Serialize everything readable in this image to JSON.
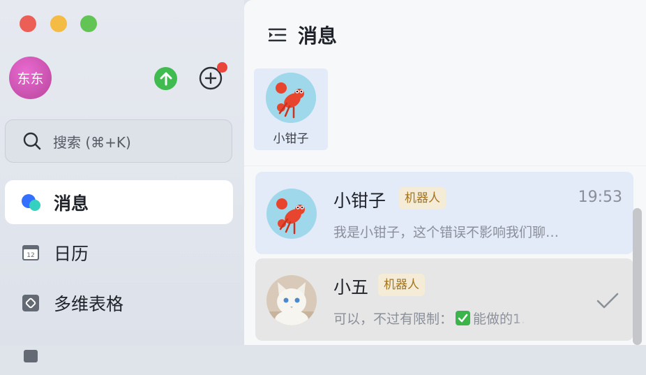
{
  "window": {
    "controls": [
      "close",
      "minimize",
      "zoom"
    ]
  },
  "sidebar": {
    "avatar_text": "东东",
    "search_label": "搜索 (⌘+K)",
    "nav": [
      {
        "label": "消息",
        "icon": "chat-bubbles-icon",
        "active": true
      },
      {
        "label": "日历",
        "icon": "calendar-icon",
        "calendar_day": "12"
      },
      {
        "label": "多维表格",
        "icon": "base-table-icon"
      }
    ]
  },
  "main": {
    "title": "消息",
    "pinned": [
      {
        "name": "小钳子",
        "avatar": "lobster-avatar"
      }
    ],
    "chats": [
      {
        "name": "小钳子",
        "tag": "机器人",
        "time": "19:53",
        "message": "我是小钳子，这个错误不影响我们聊…",
        "avatar": "lobster-avatar",
        "selected": true
      },
      {
        "name": "小五",
        "tag": "机器人",
        "message_prefix": "可以，不过有限制：",
        "message_suffix": "能做的1.",
        "avatar": "white-cat-avatar",
        "done": true
      }
    ]
  },
  "colors": {
    "accent_blue": "#3370ff",
    "green": "#3fbb4f",
    "red_badge": "#e9453a",
    "tag_bg": "#f5ecd7",
    "tag_fg": "#a4741e"
  }
}
